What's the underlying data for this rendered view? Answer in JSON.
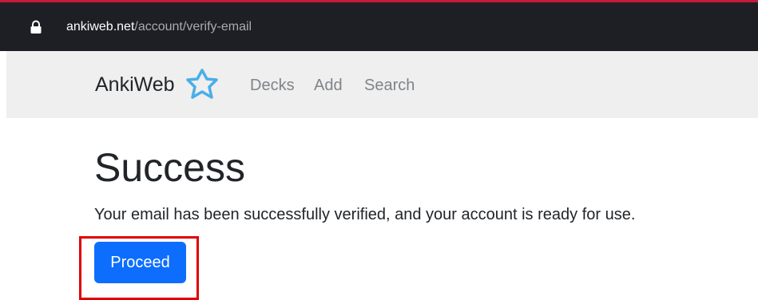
{
  "browser": {
    "url_host": "ankiweb.net",
    "url_path": "/account/verify-email",
    "lock_icon": "lock-icon"
  },
  "navbar": {
    "brand": "AnkiWeb",
    "brand_icon": "star-outline-icon",
    "links": [
      "Decks",
      "Add",
      "Search"
    ]
  },
  "main": {
    "title": "Success",
    "message": "Your email has been successfully verified, and your account is ready for use.",
    "button_label": "Proceed"
  },
  "colors": {
    "address_bar": "#1d1f25",
    "navbar_bg": "#efefef",
    "primary_button": "#0d6efd",
    "brand_star": "#4aaee8",
    "highlight_box": "#e00000"
  }
}
